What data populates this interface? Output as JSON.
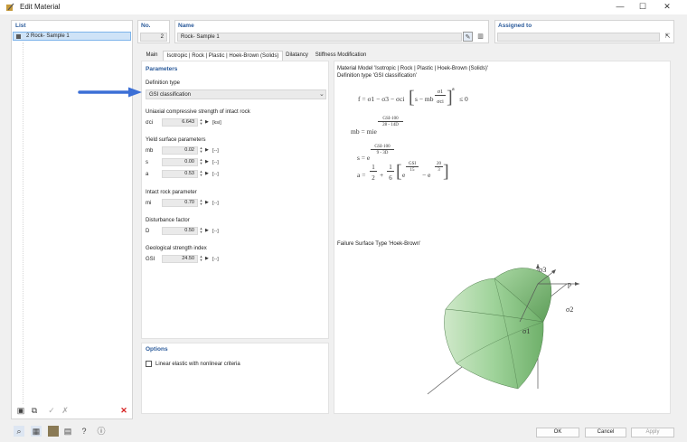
{
  "window": {
    "title": "Edit Material",
    "minimize": "—",
    "maximize": "☐",
    "close": "✕"
  },
  "list": {
    "header": "List",
    "items": [
      {
        "label": "2  Rock- Sample 1"
      }
    ]
  },
  "no": {
    "header": "No.",
    "value": "2"
  },
  "name": {
    "header": "Name",
    "value": "Rock- Sample 1"
  },
  "assigned": {
    "header": "Assigned to",
    "value": ""
  },
  "tabs": [
    {
      "label": "Main"
    },
    {
      "label": "Isotropic | Rock | Plastic | Hoek-Brown (Solids)"
    },
    {
      "label": "Dilatancy"
    },
    {
      "label": "Stiffness Modification"
    }
  ],
  "parameters": {
    "header": "Parameters",
    "definition_type": {
      "label": "Definition type",
      "value": "GSI classification"
    },
    "ucs": {
      "label": "Uniaxial compressive strength of intact rock",
      "symbol": "σci",
      "value": "6.643",
      "unit": "[ksi]"
    },
    "yield": {
      "label": "Yield surface parameters",
      "rows": [
        {
          "symbol": "mb",
          "value": "0.02",
          "unit": "[--]"
        },
        {
          "symbol": "s",
          "value": "0.00",
          "unit": "[--]"
        },
        {
          "symbol": "a",
          "value": "0.53",
          "unit": "[--]"
        }
      ]
    },
    "intact": {
      "label": "Intact rock parameter",
      "symbol": "mi",
      "value": "0.70",
      "unit": "[--]"
    },
    "disturbance": {
      "label": "Disturbance factor",
      "symbol": "D",
      "value": "0.50",
      "unit": "[--]"
    },
    "gsi": {
      "label": "Geological strength index",
      "symbol": "GSI",
      "value": "24.50",
      "unit": "[--]"
    }
  },
  "options": {
    "header": "Options",
    "checkbox_label": "Linear elastic with nonlinear criteria",
    "checked": false
  },
  "info": {
    "model_line": "Material Model 'Isotropic | Rock | Plastic | Hoek-Brown (Solids)'",
    "deftype_line": "Definition type 'GSI classification'",
    "failure_title": "Failure Surface Type 'Hoek-Brown'",
    "axis_sigma3": "σ3",
    "axis_sigma2": "σ2",
    "axis_sigma1": "σ1",
    "axis_p": "p"
  },
  "formulas": {
    "f_lhs": "f = σ1 − σ3 − σci",
    "f_inner": "s − mb",
    "f_frac_num": "σ1",
    "f_frac_den": "σci",
    "f_exp": "a",
    "f_rhs": "≤  0",
    "mb_lhs": "mb = mie",
    "mb_num": "GSI-100",
    "mb_den": "28 - 14D",
    "s_lhs": "s = e",
    "s_num": "GSI-100",
    "s_den": "9 - 3D",
    "a_lhs": "a =",
    "a_half_num": "1",
    "a_half_den": "2",
    "a_plus": "+",
    "a_sixth_num": "1",
    "a_sixth_den": "6",
    "a_e1": "e",
    "a_e1_exp_num": "GSI",
    "a_e1_exp_den": "15",
    "a_minus": "− e",
    "a_e2_exp_num": "20",
    "a_e2_exp_den": "3"
  },
  "buttons": {
    "ok": "OK",
    "cancel": "Cancel",
    "apply": "Apply"
  },
  "colors": {
    "accent": "#2a5a9a",
    "surface": "#8fc98a",
    "arrow": "#3b6fd6"
  }
}
